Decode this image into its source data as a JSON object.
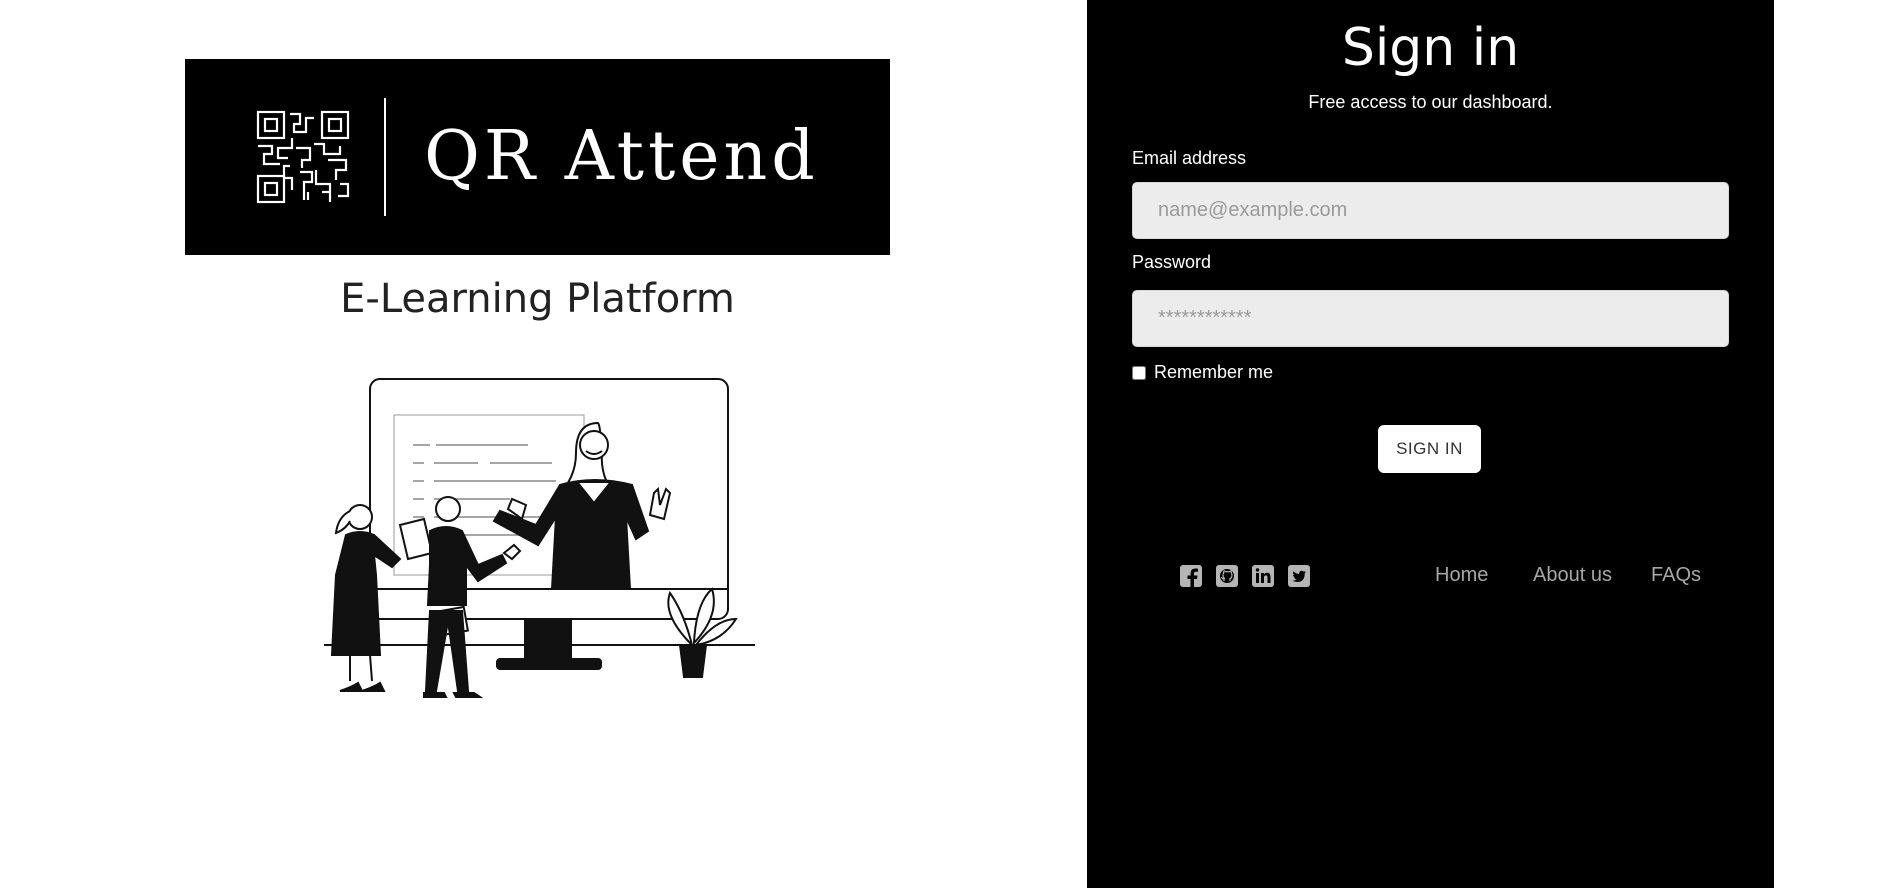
{
  "brand": {
    "name": "QR Attend",
    "tagline": "E-Learning Platform"
  },
  "signin": {
    "title": "Sign in",
    "subtitle": "Free access to our dashboard.",
    "email_label": "Email address",
    "email_placeholder": "name@example.com",
    "password_label": "Password",
    "password_placeholder": "************",
    "remember_label": "Remember me",
    "remember_checked": false,
    "button_label": "SIGN IN"
  },
  "footer": {
    "socials": [
      "facebook-icon",
      "github-icon",
      "linkedin-icon",
      "twitter-icon"
    ],
    "links": [
      "Home",
      "About us",
      "FAQs"
    ]
  },
  "colors": {
    "panel": "#000000",
    "page": "#ffffff",
    "input_bg": "#ececec",
    "link": "#a6a6a6"
  }
}
